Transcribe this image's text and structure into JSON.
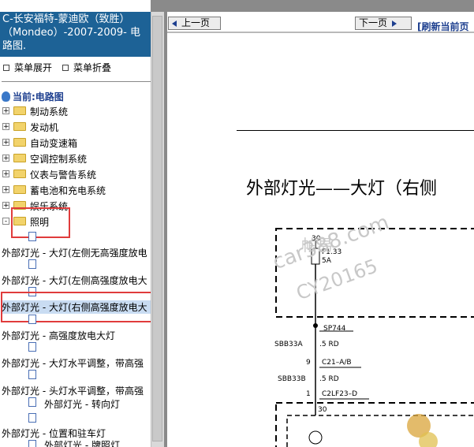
{
  "left": {
    "title": "C-长安福特-蒙迪欧（致胜）（Mondeo）-2007-2009- 电路图.",
    "expand_all": "菜单展开",
    "collapse_all": "菜单折叠",
    "current": "当前:电路图",
    "folders": [
      "制动系统",
      "发动机",
      "自动变速箱",
      "空调控制系统",
      "仪表与警告系统",
      "蓄电池和充电系统",
      "娱乐系统",
      "照明"
    ],
    "folder_states": [
      "+",
      "+",
      "+",
      "+",
      "+",
      "+",
      "+",
      "-"
    ],
    "leaves": [
      "外部灯光 - 大灯(左侧无高强度放电",
      "外部灯光 - 大灯(左侧高强度放电大",
      "外部灯光 - 大灯(右侧高强度放电大",
      "外部灯光 - 高强度放电大灯",
      "外部灯光 - 大灯水平调整，带高强",
      "外部灯光 - 头灯水平调整，带高强",
      "外部灯光 - 转向灯",
      "外部灯光 - 位置和驻车灯",
      "外部灯光 - 牌照灯"
    ]
  },
  "right": {
    "prev_label": "上一页",
    "next_label": "下一页",
    "refresh_label": "[刷新当前页",
    "diagram_title": "外部灯光——大灯（右侧",
    "watermark_a": "帕易",
    "watermark_b": "car388.com",
    "watermark_c": "CY20165",
    "labels": {
      "n30a": "30",
      "fuse": "F1.33",
      "fuse_amp": "5A",
      "sp": "SP744",
      "w1": "SBB33A",
      "w1s": ".5 RD",
      "pin9": "9",
      "conn1": "C21–A/B",
      "w2": "SBB33B",
      "w2s": ".5 RD",
      "pin1": "1",
      "conn2": "C2LF23–D",
      "n30b": "30"
    }
  },
  "colors": {
    "header_bg": "#1d6296",
    "highlight_box": "#e03c3c",
    "selected_bg": "#c9dcf2"
  }
}
